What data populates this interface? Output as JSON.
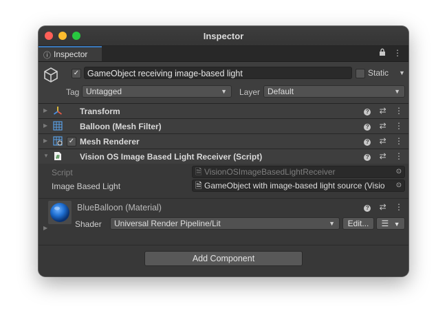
{
  "window": {
    "title": "Inspector"
  },
  "tab": {
    "label": "Inspector",
    "icon": "info-icon"
  },
  "gameobject": {
    "active": true,
    "name": "GameObject receiving image-based light",
    "static_label": "Static",
    "static_checked": false,
    "tag_label": "Tag",
    "tag_value": "Untagged",
    "layer_label": "Layer",
    "layer_value": "Default"
  },
  "components": [
    {
      "label": "Transform",
      "icon": "transform-icon"
    },
    {
      "label": "Balloon (Mesh Filter)",
      "icon": "mesh-filter-icon"
    },
    {
      "label": "Mesh Renderer",
      "icon": "mesh-renderer-icon",
      "enabled": true
    },
    {
      "label": "Vision OS Image Based Light Receiver (Script)",
      "icon": "script-icon",
      "expanded": true
    }
  ],
  "script_props": {
    "script_label": "Script",
    "script_value": "VisionOSImageBasedLightReceiver",
    "ibl_label": "Image Based Light",
    "ibl_value": "GameObject with image-based light source (Visio"
  },
  "material": {
    "name": "BlueBalloon (Material)",
    "shader_label": "Shader",
    "shader_value": "Universal Render Pipeline/Lit",
    "edit_label": "Edit..."
  },
  "footer": {
    "add_component_label": "Add Component"
  },
  "colors": {
    "accent": "#3a79bb",
    "balloon": "#1f6fd1"
  }
}
